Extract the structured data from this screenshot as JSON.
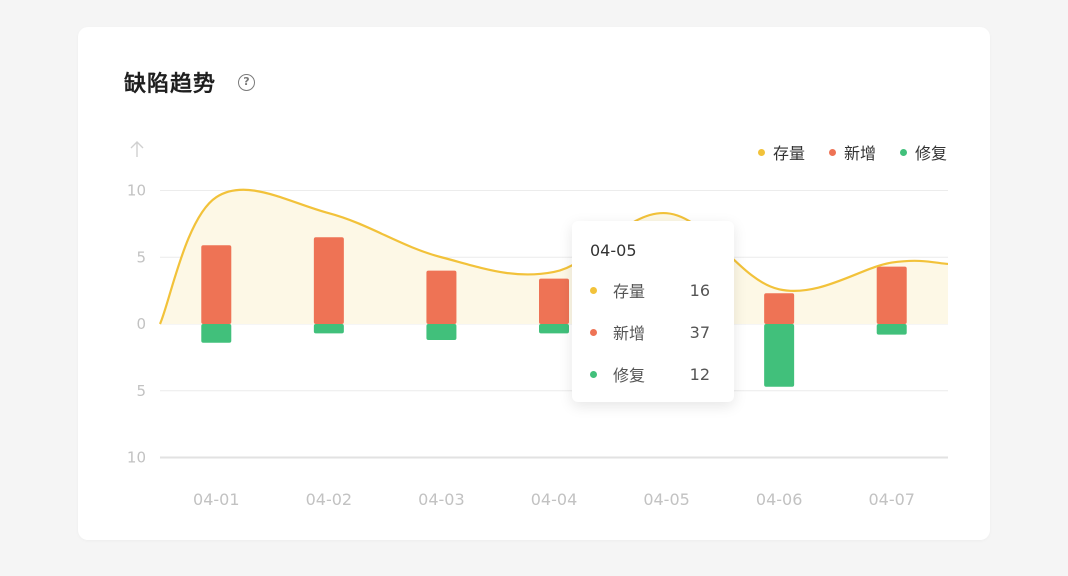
{
  "title": "缺陷趋势",
  "help_icon": "help-circle-icon",
  "colors": {
    "stock": "#f2c23a",
    "stock_fill": "#fdf8e6",
    "added": "#ee7355",
    "fixed": "#41c07b",
    "grid": "#ececec",
    "axis_text": "#c2c2c2"
  },
  "legend": {
    "stock": "存量",
    "added": "新增",
    "fixed": "修复"
  },
  "tooltip": {
    "title": "04-05",
    "rows": [
      {
        "name": "存量",
        "value": "16"
      },
      {
        "name": "新增",
        "value": "37"
      },
      {
        "name": "修复",
        "value": "12"
      }
    ]
  },
  "chart_data": {
    "type": "bar",
    "categories": [
      "04-01",
      "04-02",
      "04-03",
      "04-04",
      "04-05",
      "04-06",
      "04-07"
    ],
    "y_axis_ticks": [
      "10",
      "5",
      "0",
      "5",
      "10"
    ],
    "y_axis_icon": "arrow-up-icon",
    "ylim": [
      -10,
      10
    ],
    "series": [
      {
        "name": "新增",
        "type": "bar",
        "values": [
          5.9,
          6.5,
          4.0,
          3.4,
          null,
          2.3,
          4.3
        ]
      },
      {
        "name": "修复",
        "type": "bar",
        "values": [
          -1.4,
          -0.7,
          -1.2,
          -0.7,
          null,
          -4.7,
          -0.8
        ]
      },
      {
        "name": "存量",
        "type": "area",
        "values": [
          9.5,
          8.3,
          5.0,
          3.9,
          8.3,
          2.6,
          4.6
        ]
      }
    ]
  }
}
